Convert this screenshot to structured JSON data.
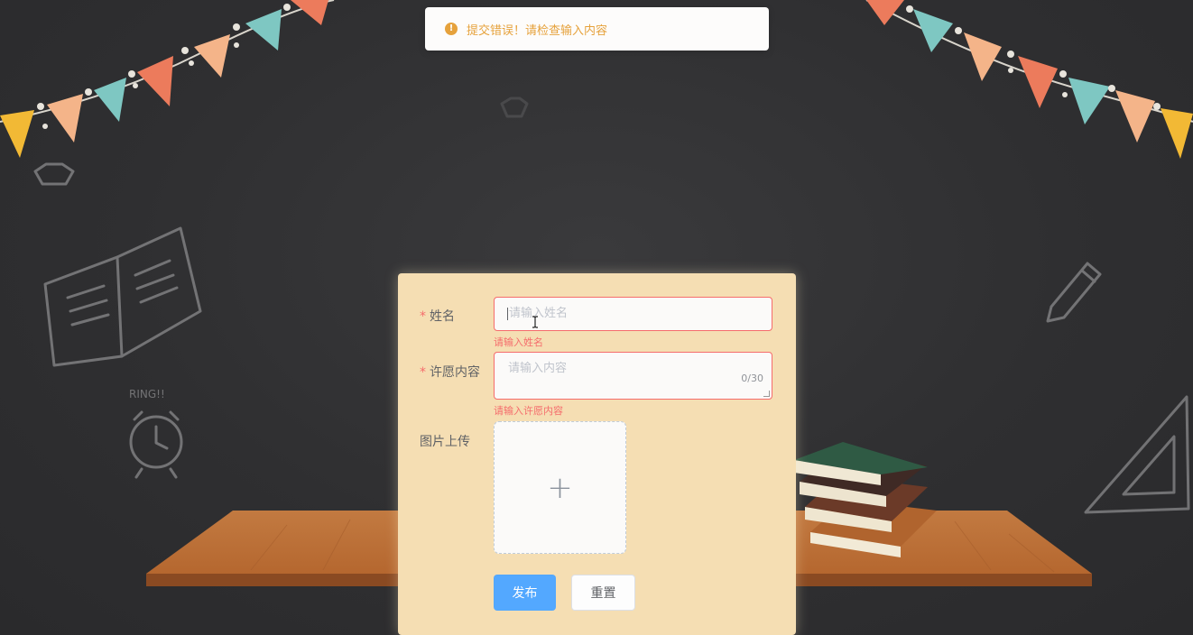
{
  "toast": {
    "icon": "warning-icon",
    "text": "提交错误！请检查输入内容",
    "color": "#e6a23c"
  },
  "form": {
    "name": {
      "label": "姓名",
      "required_mark": "*",
      "placeholder": "请输入姓名",
      "error": "请输入姓名"
    },
    "wish": {
      "label": "许愿内容",
      "required_mark": "*",
      "placeholder": "请输入内容",
      "counter": "0/30",
      "error": "请输入许愿内容"
    },
    "image": {
      "label": "图片上传",
      "upload_icon": "+"
    },
    "buttons": {
      "publish": "发布",
      "reset": "重置"
    }
  },
  "decor": {
    "clock_text": "RING!!"
  },
  "colors": {
    "error": "#f56c6c",
    "primary": "#53a8ff",
    "card": "#f5deb3",
    "background": "#2f2f31"
  }
}
